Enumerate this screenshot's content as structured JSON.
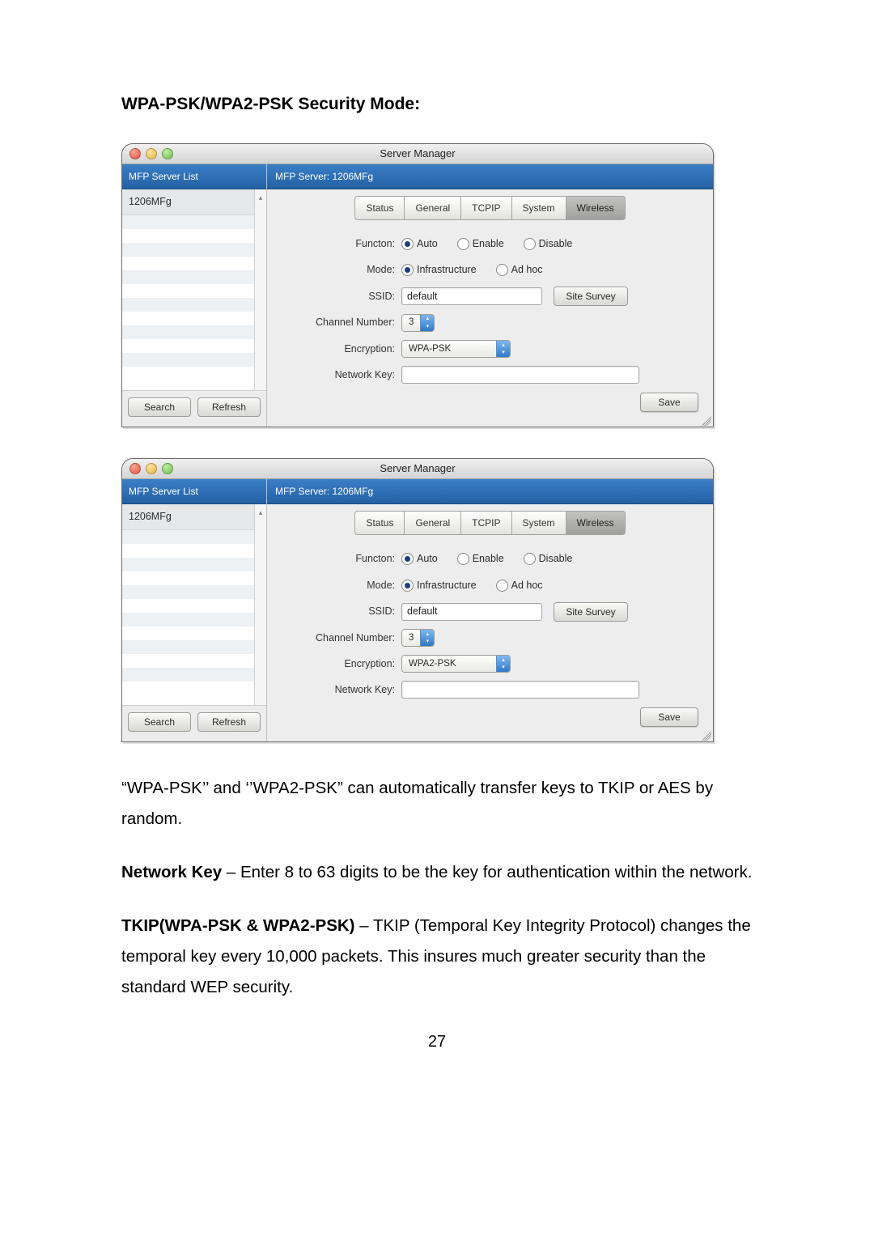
{
  "heading": "WPA-PSK/WPA2-PSK Security Mode:",
  "window_title": "Server Manager",
  "sidebar_header": "MFP Server List",
  "sidebar_item": "1206MFg",
  "search_btn": "Search",
  "refresh_btn": "Refresh",
  "main_header_prefix": "MFP Server: ",
  "main_header_name": "1206MFg",
  "tabs": {
    "status": "Status",
    "general": "General",
    "tcpip": "TCPIP",
    "system": "System",
    "wireless": "Wireless"
  },
  "labels": {
    "function": "Functon:",
    "mode": "Mode:",
    "ssid": "SSID:",
    "channel": "Channel Number:",
    "encryption": "Encryption:",
    "network_key": "Network Key:"
  },
  "radio": {
    "auto": "Auto",
    "enable": "Enable",
    "disable": "Disable",
    "infrastructure": "Infrastructure",
    "adhoc": "Ad hoc"
  },
  "ssid_value": "default",
  "channel_value": "3",
  "site_survey_btn": "Site Survey",
  "save_btn": "Save",
  "encryption_value_1": "WPA-PSK",
  "encryption_value_2": "WPA2-PSK",
  "paragraph1": "“WPA-PSK’’ and ‘’WPA2-PSK” can automatically transfer keys to TKIP or AES by random.",
  "p2_label": "Network Key",
  "p2_rest": " – Enter 8 to 63 digits to be the key for authentication within the network.",
  "p3_label": "TKIP(WPA-PSK & WPA2-PSK)",
  "p3_rest": " – TKIP (Temporal Key Integrity Protocol) changes the temporal key every 10,000 packets. This insures much greater security than the standard WEP security.",
  "page_number": "27"
}
